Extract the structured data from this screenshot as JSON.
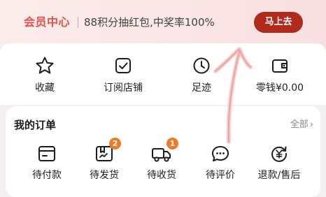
{
  "banner": {
    "title": "会员中心",
    "promo": "88积分抽红包,中奖率100%",
    "button_label": "马上去"
  },
  "quick_links": [
    {
      "label": "收藏",
      "icon": "star-icon"
    },
    {
      "label": "订阅店铺",
      "icon": "subscribe-check-icon"
    },
    {
      "label": "足迹",
      "icon": "clock-icon"
    },
    {
      "label": "零钱¥0.00",
      "icon": "wallet-icon"
    }
  ],
  "orders": {
    "title": "我的订单",
    "all_label": "全部",
    "items": [
      {
        "label": "待付款",
        "icon": "card-icon",
        "badge": ""
      },
      {
        "label": "待发货",
        "icon": "package-icon",
        "badge": "2"
      },
      {
        "label": "待收货",
        "icon": "truck-icon",
        "badge": "1"
      },
      {
        "label": "待评价",
        "icon": "comment-icon",
        "badge": ""
      },
      {
        "label": "退款/售后",
        "icon": "refund-icon",
        "badge": ""
      }
    ]
  },
  "colors": {
    "accent": "#e0524a",
    "button": "#b02b1b",
    "badge": "#f07a23"
  }
}
